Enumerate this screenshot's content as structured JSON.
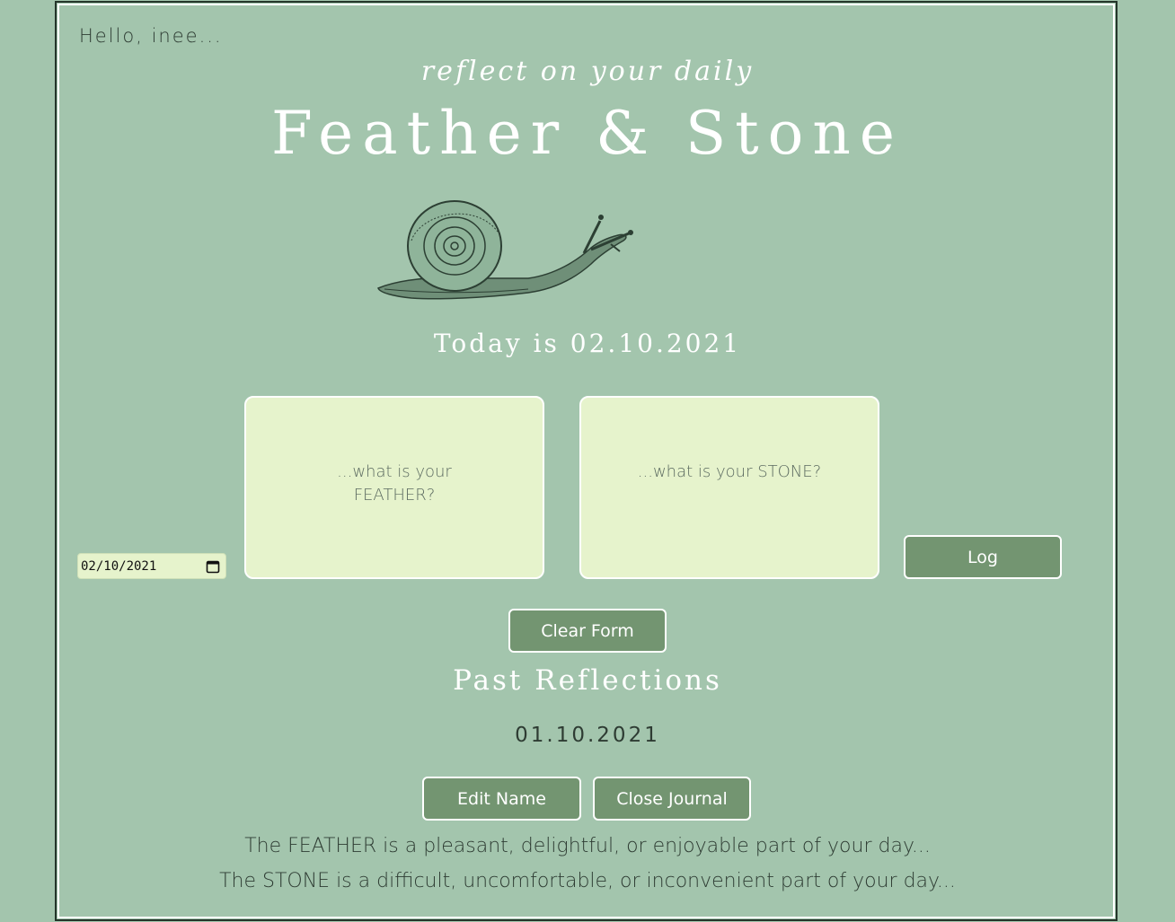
{
  "greeting": "Hello, inee...",
  "subtitle": "reflect on your daily",
  "title": "Feather & Stone",
  "today_text": "Today is 02.10.2021",
  "date_input": {
    "value": "02/10/2021"
  },
  "feather_card": {
    "placeholder": "...what is your FEATHER?"
  },
  "stone_card": {
    "placeholder": "...what is your STONE?"
  },
  "buttons": {
    "log": "Log",
    "clear": "Clear Form",
    "edit_name": "Edit Name",
    "close_journal": "Close Journal"
  },
  "past": {
    "heading": "Past Reflections",
    "entries": [
      "01.10.2021"
    ]
  },
  "explanations": {
    "feather": "The FEATHER is a pleasant, delightful, or enjoyable part of your day...",
    "stone": "The STONE is a difficult, uncomfortable, or inconvenient part of your day..."
  },
  "icons": {
    "calendar": "calendar-icon",
    "snail": "snail-illustration"
  },
  "colors": {
    "background": "#a3c5ad",
    "card": "#e6f3cc",
    "button": "#739571",
    "text_dark": "#2e3c33"
  }
}
